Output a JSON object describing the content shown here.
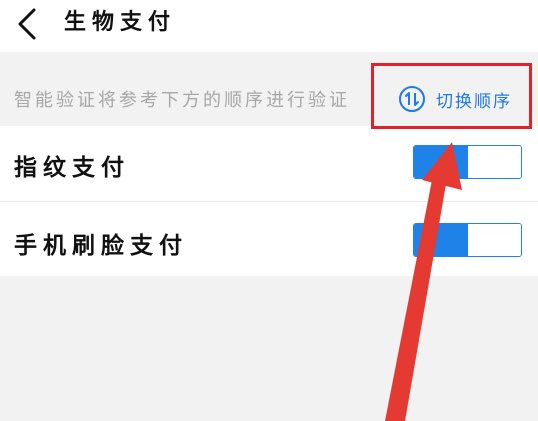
{
  "header": {
    "title": "生物支付",
    "back_icon": "chevron-left-icon"
  },
  "hint": {
    "text": "智能验证将参考下方的顺序进行验证",
    "switch_label": "切换顺序",
    "switch_icon": "sort-order-icon"
  },
  "methods": [
    {
      "label": "指纹支付",
      "enabled": true
    },
    {
      "label": "手机刷脸支付",
      "enabled": true
    }
  ],
  "colors": {
    "accent": "#1f82e8",
    "link": "#2079e6",
    "annotation": "#e0222d",
    "hint_text": "#a7a7a7",
    "background": "#f2f2f2"
  },
  "annotation": {
    "type": "red-box-and-arrow",
    "target": "switch-order-button"
  }
}
